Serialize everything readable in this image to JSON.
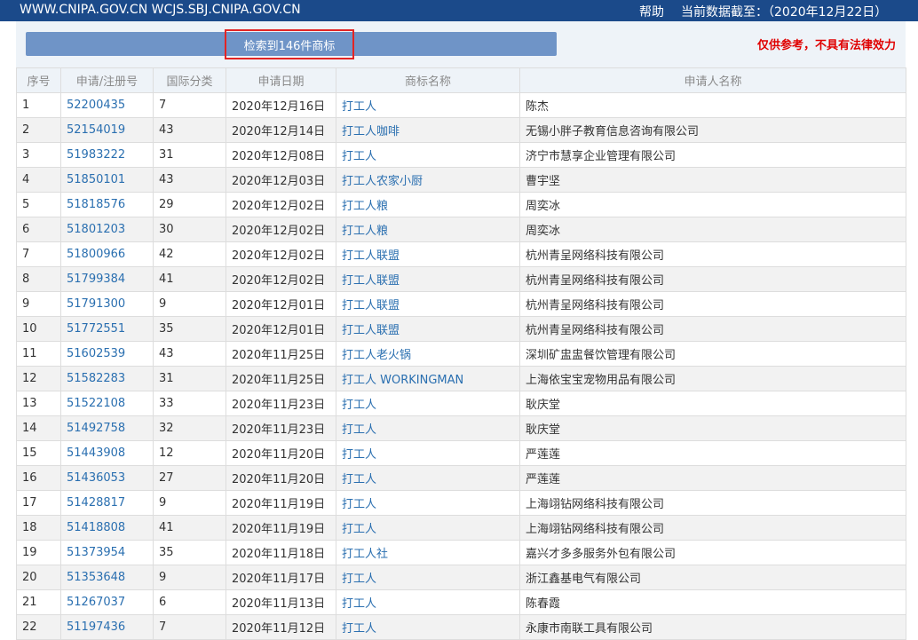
{
  "header": {
    "sites": "WWW.CNIPA.GOV.CN WCJS.SBJ.CNIPA.GOV.CN",
    "help": "帮助",
    "data_cutoff": "当前数据截至：（2020年12月22日）"
  },
  "summary": {
    "result_text": "检索到146件商标",
    "disclaimer": "仅供参考，不具有法律效力"
  },
  "table": {
    "columns": [
      "序号",
      "申请/注册号",
      "国际分类",
      "申请日期",
      "商标名称",
      "申请人名称"
    ],
    "rows": [
      [
        "1",
        "52200435",
        "7",
        "2020年12月16日",
        "打工人",
        "陈杰"
      ],
      [
        "2",
        "52154019",
        "43",
        "2020年12月14日",
        "打工人咖啡",
        "无锡小胖子教育信息咨询有限公司"
      ],
      [
        "3",
        "51983222",
        "31",
        "2020年12月08日",
        "打工人",
        "济宁市慧享企业管理有限公司"
      ],
      [
        "4",
        "51850101",
        "43",
        "2020年12月03日",
        "打工人农家小厨",
        "曹宇坚"
      ],
      [
        "5",
        "51818576",
        "29",
        "2020年12月02日",
        "打工人粮",
        "周奕冰"
      ],
      [
        "6",
        "51801203",
        "30",
        "2020年12月02日",
        "打工人粮",
        "周奕冰"
      ],
      [
        "7",
        "51800966",
        "42",
        "2020年12月02日",
        "打工人联盟",
        "杭州青呈网络科技有限公司"
      ],
      [
        "8",
        "51799384",
        "41",
        "2020年12月02日",
        "打工人联盟",
        "杭州青呈网络科技有限公司"
      ],
      [
        "9",
        "51791300",
        "9",
        "2020年12月01日",
        "打工人联盟",
        "杭州青呈网络科技有限公司"
      ],
      [
        "10",
        "51772551",
        "35",
        "2020年12月01日",
        "打工人联盟",
        "杭州青呈网络科技有限公司"
      ],
      [
        "11",
        "51602539",
        "43",
        "2020年11月25日",
        "打工人老火锅",
        "深圳矿盅盅餐饮管理有限公司"
      ],
      [
        "12",
        "51582283",
        "31",
        "2020年11月25日",
        "打工人 WORKINGMAN",
        "上海依宝宝宠物用品有限公司"
      ],
      [
        "13",
        "51522108",
        "33",
        "2020年11月23日",
        "打工人",
        "耿庆堂"
      ],
      [
        "14",
        "51492758",
        "32",
        "2020年11月23日",
        "打工人",
        "耿庆堂"
      ],
      [
        "15",
        "51443908",
        "12",
        "2020年11月20日",
        "打工人",
        "严莲莲"
      ],
      [
        "16",
        "51436053",
        "27",
        "2020年11月20日",
        "打工人",
        "严莲莲"
      ],
      [
        "17",
        "51428817",
        "9",
        "2020年11月19日",
        "打工人",
        "上海翊钻网络科技有限公司"
      ],
      [
        "18",
        "51418808",
        "41",
        "2020年11月19日",
        "打工人",
        "上海翊钻网络科技有限公司"
      ],
      [
        "19",
        "51373954",
        "35",
        "2020年11月18日",
        "打工人社",
        "嘉兴才多多服务外包有限公司"
      ],
      [
        "20",
        "51353648",
        "9",
        "2020年11月17日",
        "打工人",
        "浙江鑫基电气有限公司"
      ],
      [
        "21",
        "51267037",
        "6",
        "2020年11月13日",
        "打工人",
        "陈春霞"
      ],
      [
        "22",
        "51197436",
        "7",
        "2020年11月12日",
        "打工人",
        "永康市南联工具有限公司"
      ]
    ]
  },
  "colors": {
    "header_bg": "#1b4a8a",
    "bar_blue": "#6f94c7",
    "highlight_red": "#e32424",
    "disclaimer_red": "#e00000",
    "link_blue": "#2a6fb0"
  }
}
